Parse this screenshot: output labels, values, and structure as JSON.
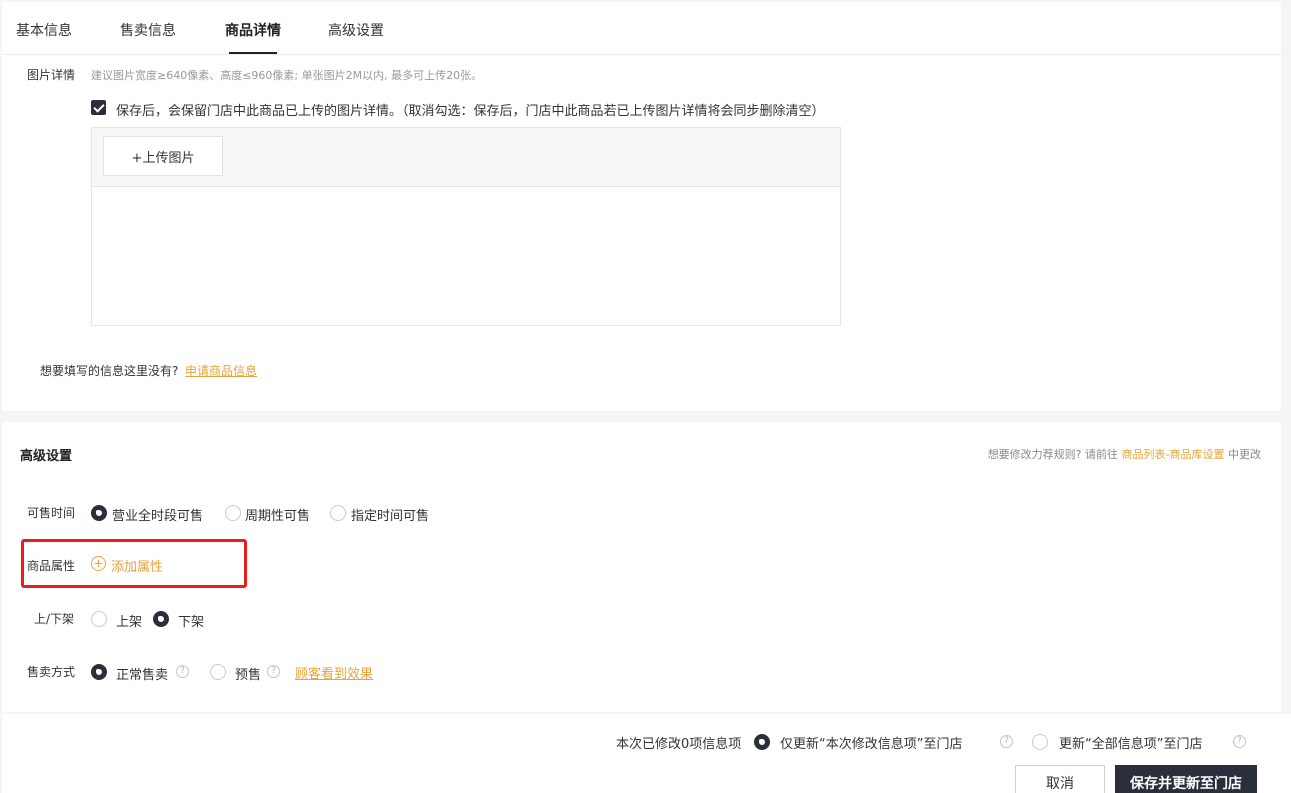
{
  "tabs": [
    {
      "label": "基本信息",
      "active": false
    },
    {
      "label": "售卖信息",
      "active": false
    },
    {
      "label": "商品详情",
      "active": true
    },
    {
      "label": "高级设置",
      "active": false
    }
  ],
  "image_detail": {
    "label": "图片详情",
    "hint": "建议图片宽度≥640像素、高度≤960像素; 单张图片2M以内, 最多可上传20张。",
    "keep_checkbox_text": "保存后，会保留门店中此商品已上传的图片详情。（取消勾选：保存后，门店中此商品若已上传图片详情将会同步删除清空）",
    "keep_checked": true,
    "upload_button": "+上传图片"
  },
  "apply_info": {
    "question": "想要填写的信息这里没有?",
    "link": "申请商品信息"
  },
  "advanced": {
    "title": "高级设置",
    "rule_hint_prefix": "想要修改力荐规则? 请前往",
    "rule_hint_link": "商品列表-商品库设置",
    "rule_hint_suffix": "中更改",
    "sale_time": {
      "label": "可售时间",
      "options": [
        "营业全时段可售",
        "周期性可售",
        "指定时间可售"
      ],
      "selected": "营业全时段可售"
    },
    "attributes": {
      "label": "商品属性",
      "add_label": "添加属性"
    },
    "shelf": {
      "label": "上/下架",
      "options": [
        "上架",
        "下架"
      ],
      "selected": "下架"
    },
    "sale_mode": {
      "label": "售卖方式",
      "options": [
        "正常售卖",
        "预售"
      ],
      "selected": "正常售卖",
      "preview_link": "顾客看到效果"
    }
  },
  "footer": {
    "changed_text": "本次已修改0项信息项",
    "option_partial": "仅更新“本次修改信息项”至门店",
    "option_all": "更新“全部信息项”至门店",
    "selected": "partial",
    "cancel_label": "取消",
    "save_label": "保存并更新至门店"
  },
  "colors": {
    "accent": "#e8a33b",
    "dark": "#2b2e3b",
    "highlight_border": "#ea1c1c"
  }
}
